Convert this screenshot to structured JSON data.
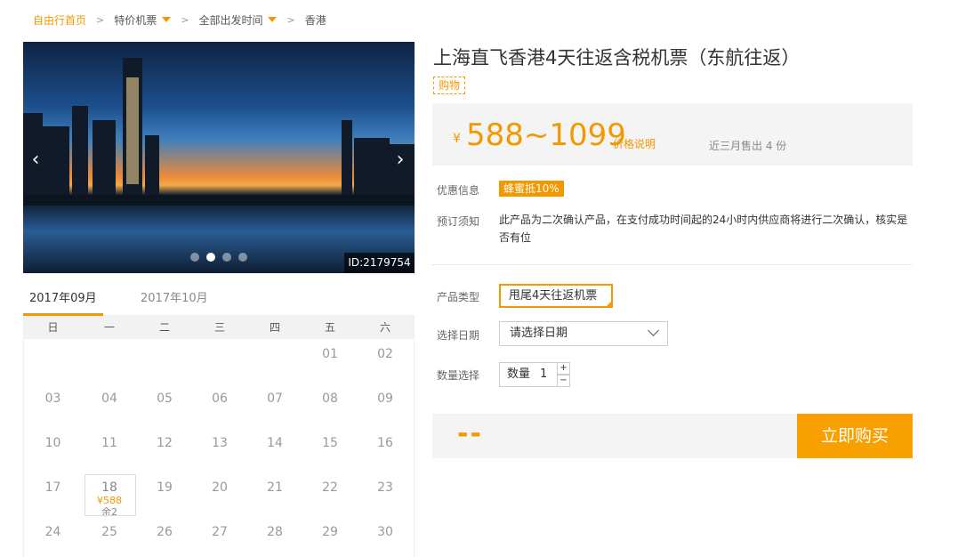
{
  "breadcrumb": {
    "home": "自由行首页",
    "category": "特价机票",
    "departure": "全部出发时间",
    "destination": "香港"
  },
  "hero": {
    "image_id": "ID:2179754",
    "prev_icon": "chevron-left-icon",
    "next_icon": "chevron-right-icon",
    "slide_count": 4,
    "active_slide": 1
  },
  "calendar": {
    "tabs": [
      "2017年09月",
      "2017年10月"
    ],
    "active_tab": 0,
    "weekdays": [
      "日",
      "一",
      "二",
      "三",
      "四",
      "五",
      "六"
    ],
    "weeks": [
      [
        {
          "day": ""
        },
        {
          "day": ""
        },
        {
          "day": ""
        },
        {
          "day": ""
        },
        {
          "day": ""
        },
        {
          "day": "01"
        },
        {
          "day": "02"
        }
      ],
      [
        {
          "day": "03"
        },
        {
          "day": "04"
        },
        {
          "day": "05"
        },
        {
          "day": "06"
        },
        {
          "day": "07"
        },
        {
          "day": "08"
        },
        {
          "day": "09"
        }
      ],
      [
        {
          "day": "10"
        },
        {
          "day": "11"
        },
        {
          "day": "12"
        },
        {
          "day": "13"
        },
        {
          "day": "14"
        },
        {
          "day": "15"
        },
        {
          "day": "16"
        }
      ],
      [
        {
          "day": "17"
        },
        {
          "day": "18",
          "price": "¥588",
          "stock": "余2"
        },
        {
          "day": "19"
        },
        {
          "day": "20"
        },
        {
          "day": "21"
        },
        {
          "day": "22"
        },
        {
          "day": "23"
        }
      ],
      [
        {
          "day": "24"
        },
        {
          "day": "25"
        },
        {
          "day": "26"
        },
        {
          "day": "27"
        },
        {
          "day": "28"
        },
        {
          "day": "29"
        },
        {
          "day": "30"
        }
      ]
    ]
  },
  "product": {
    "title": "上海直飞香港4天往返含税机票（东航往返）",
    "tag": "购物",
    "currency": "¥",
    "price_range": "588~1099",
    "price_note": "价格说明",
    "sold": "近三月售出 4 份",
    "promo_label": "优惠信息",
    "promo_badge": "蜂蜜抵10%",
    "notice_label": "预订须知",
    "notice_text": "此产品为二次确认产品，在支付成功时间起的24小时内供应商将进行二次确认，核实是否有位",
    "type_label": "产品类型",
    "type_value": "甩尾4天往返机票",
    "date_label": "选择日期",
    "date_value": "请选择日期",
    "qty_label": "数量选择",
    "qty_text": "数量",
    "qty_value": "1",
    "qty_plus": "+",
    "qty_minus": "−"
  },
  "buy": {
    "total": "--",
    "button": "立即购买"
  },
  "colors": {
    "accent": "#f39800",
    "button": "#f7a000"
  }
}
